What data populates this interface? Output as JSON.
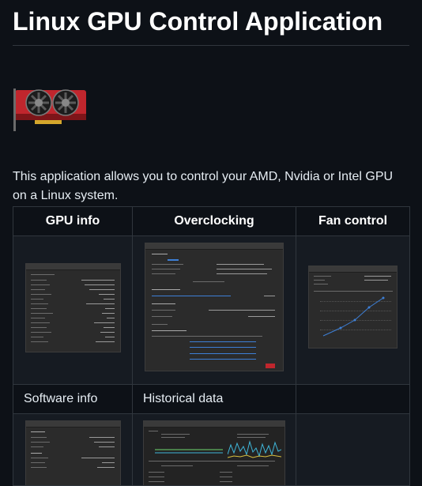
{
  "page": {
    "title": "Linux GPU Control Application",
    "description": "This application allows you to control your AMD, Nvidia or Intel GPU on a Linux system."
  },
  "table": {
    "headers": [
      "GPU info",
      "Overclocking",
      "Fan control"
    ],
    "row2_labels": [
      "Software info",
      "Historical data",
      ""
    ]
  },
  "icons": {
    "logo": "graphics-card-icon"
  },
  "colors": {
    "background": "#0d1117",
    "border": "#30363d",
    "alt_row": "#161b22",
    "logo_red": "#c0262d",
    "screenshot_bg": "#2b2b2b",
    "accent_blue": "#3d7fd6"
  }
}
